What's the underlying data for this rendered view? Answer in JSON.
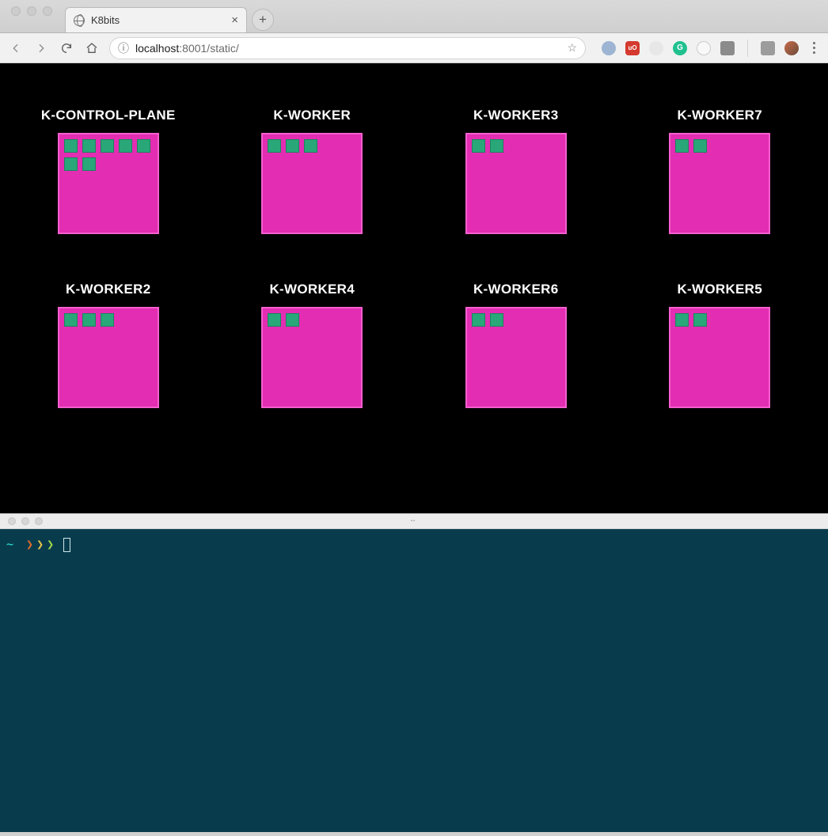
{
  "browser": {
    "tab_title": "K8bits",
    "url_host": "localhost",
    "url_port_path": ":8001/static/",
    "info_tooltip": "ⓘ",
    "extensions": {
      "e1": {
        "bg": "#9db4d3"
      },
      "e2": {
        "bg": "#d43a2f",
        "label": "uO"
      },
      "e3": {
        "bg": "#e7e7e7"
      },
      "e4": {
        "bg": "#20c18f",
        "label": "G"
      },
      "e5": {
        "bg": "#f8f8f8"
      },
      "e6": {
        "bg": "#8b8b8b"
      },
      "e7": {
        "bg": "#9c9c9c"
      },
      "e8": {
        "bg": "linear-gradient(135deg,#c96a4a,#6a4b3a)"
      }
    }
  },
  "nodes": [
    {
      "name": "K-CONTROL-PLANE",
      "pods": 7
    },
    {
      "name": "K-WORKER",
      "pods": 3
    },
    {
      "name": "K-WORKER3",
      "pods": 2
    },
    {
      "name": "K-WORKER7",
      "pods": 2
    },
    {
      "name": "K-WORKER2",
      "pods": 3
    },
    {
      "name": "K-WORKER4",
      "pods": 2
    },
    {
      "name": "K-WORKER6",
      "pods": 2
    },
    {
      "name": "K-WORKER5",
      "pods": 2
    }
  ],
  "terminal": {
    "prompt_path": "~",
    "arrows": "❯❯❯"
  },
  "colors": {
    "node_box": "#e32db2",
    "node_border": "#f45fcf",
    "pod": "#2aa779",
    "terminal_bg": "#083c4d"
  }
}
